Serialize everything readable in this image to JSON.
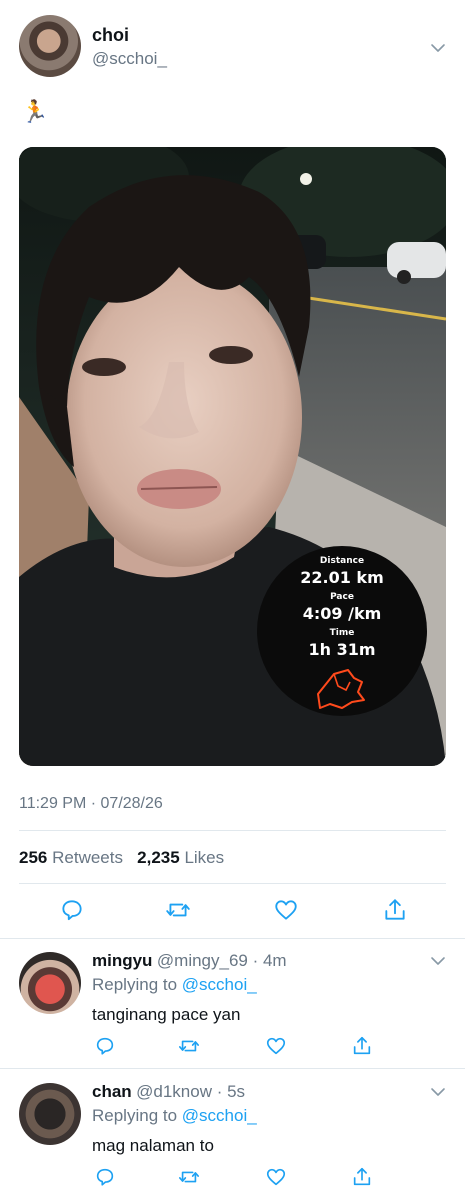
{
  "tweet": {
    "author_name": "choi",
    "author_handle": "@scchoi_",
    "emoji": "🏃",
    "run_stats": {
      "distance_label": "Distance",
      "distance_value": "22.01 km",
      "pace_label": "Pace",
      "pace_value": "4:09 /km",
      "time_label": "Time",
      "time_value": "1h 31m"
    },
    "timestamp": "11:29 PM · 07/28/26",
    "retweets_count": "256",
    "retweets_label": "Retweets",
    "likes_count": "2,235",
    "likes_label": "Likes"
  },
  "replies": [
    {
      "name": "mingyu",
      "meta": "@mingy_69 · 4m",
      "replying_prefix": "Replying to ",
      "replying_to": "@scchoi_",
      "text": "tanginang pace yan"
    },
    {
      "name": "chan",
      "meta": "@d1know · 5s",
      "replying_prefix": "Replying to ",
      "replying_to": "@scchoi_",
      "text": "mag nalaman to"
    }
  ],
  "colors": {
    "link": "#1da1f2",
    "secondary_text": "#687684",
    "primary_text": "#0f1419",
    "divider": "#e1e8ed",
    "route_line": "#ff4a1c"
  },
  "icons": [
    "chevron-down-icon",
    "reply-icon",
    "retweet-icon",
    "like-icon",
    "share-icon"
  ]
}
